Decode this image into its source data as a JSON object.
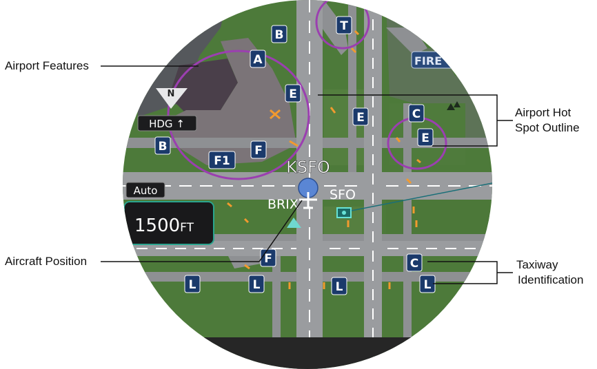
{
  "callouts": {
    "airport_features": "Airport Features",
    "hot_spot_line1": "Airport Hot",
    "hot_spot_line2": "Spot Outline",
    "aircraft_position": "Aircraft Position",
    "taxiway_line1": "Taxiway",
    "taxiway_line2": "Identification"
  },
  "map": {
    "airport_label": "KSFO",
    "waypoint_sfo": "SFO",
    "waypoint_brix": "BRIX",
    "fire_label": "FIRE",
    "orientation_label": "HDG ↑",
    "north_label": "N",
    "mode_label": "Auto",
    "range_value": "1500",
    "range_unit": "FT"
  },
  "taxiway_labels": [
    "A",
    "B",
    "B",
    "C",
    "C",
    "E",
    "E",
    "E",
    "F",
    "F",
    "F1",
    "L",
    "L",
    "L",
    "L",
    "T"
  ],
  "colors": {
    "grass": "#4e7a3c",
    "runway": "#8f9194",
    "hot_spot": "#9b3fb0",
    "taxiway_tag_bg": "#1b3a6b",
    "aircraft": "#5a86d4",
    "range_border": "#2aa58f"
  },
  "icons": [
    "north-arrow-icon",
    "aircraft-icon",
    "vor-icon",
    "triangle-waypoint-icon",
    "tree-icon"
  ]
}
